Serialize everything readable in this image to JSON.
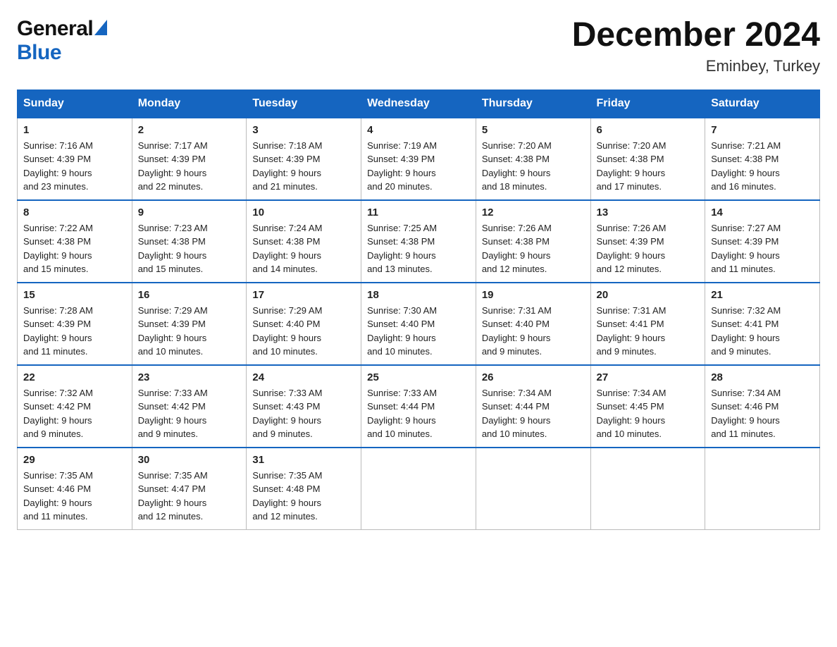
{
  "logo": {
    "general": "General",
    "blue": "Blue"
  },
  "title": "December 2024",
  "subtitle": "Eminbey, Turkey",
  "days_of_week": [
    "Sunday",
    "Monday",
    "Tuesday",
    "Wednesday",
    "Thursday",
    "Friday",
    "Saturday"
  ],
  "weeks": [
    [
      {
        "day": "1",
        "sunrise": "7:16 AM",
        "sunset": "4:39 PM",
        "daylight": "9 hours and 23 minutes."
      },
      {
        "day": "2",
        "sunrise": "7:17 AM",
        "sunset": "4:39 PM",
        "daylight": "9 hours and 22 minutes."
      },
      {
        "day": "3",
        "sunrise": "7:18 AM",
        "sunset": "4:39 PM",
        "daylight": "9 hours and 21 minutes."
      },
      {
        "day": "4",
        "sunrise": "7:19 AM",
        "sunset": "4:39 PM",
        "daylight": "9 hours and 20 minutes."
      },
      {
        "day": "5",
        "sunrise": "7:20 AM",
        "sunset": "4:38 PM",
        "daylight": "9 hours and 18 minutes."
      },
      {
        "day": "6",
        "sunrise": "7:20 AM",
        "sunset": "4:38 PM",
        "daylight": "9 hours and 17 minutes."
      },
      {
        "day": "7",
        "sunrise": "7:21 AM",
        "sunset": "4:38 PM",
        "daylight": "9 hours and 16 minutes."
      }
    ],
    [
      {
        "day": "8",
        "sunrise": "7:22 AM",
        "sunset": "4:38 PM",
        "daylight": "9 hours and 15 minutes."
      },
      {
        "day": "9",
        "sunrise": "7:23 AM",
        "sunset": "4:38 PM",
        "daylight": "9 hours and 15 minutes."
      },
      {
        "day": "10",
        "sunrise": "7:24 AM",
        "sunset": "4:38 PM",
        "daylight": "9 hours and 14 minutes."
      },
      {
        "day": "11",
        "sunrise": "7:25 AM",
        "sunset": "4:38 PM",
        "daylight": "9 hours and 13 minutes."
      },
      {
        "day": "12",
        "sunrise": "7:26 AM",
        "sunset": "4:38 PM",
        "daylight": "9 hours and 12 minutes."
      },
      {
        "day": "13",
        "sunrise": "7:26 AM",
        "sunset": "4:39 PM",
        "daylight": "9 hours and 12 minutes."
      },
      {
        "day": "14",
        "sunrise": "7:27 AM",
        "sunset": "4:39 PM",
        "daylight": "9 hours and 11 minutes."
      }
    ],
    [
      {
        "day": "15",
        "sunrise": "7:28 AM",
        "sunset": "4:39 PM",
        "daylight": "9 hours and 11 minutes."
      },
      {
        "day": "16",
        "sunrise": "7:29 AM",
        "sunset": "4:39 PM",
        "daylight": "9 hours and 10 minutes."
      },
      {
        "day": "17",
        "sunrise": "7:29 AM",
        "sunset": "4:40 PM",
        "daylight": "9 hours and 10 minutes."
      },
      {
        "day": "18",
        "sunrise": "7:30 AM",
        "sunset": "4:40 PM",
        "daylight": "9 hours and 10 minutes."
      },
      {
        "day": "19",
        "sunrise": "7:31 AM",
        "sunset": "4:40 PM",
        "daylight": "9 hours and 9 minutes."
      },
      {
        "day": "20",
        "sunrise": "7:31 AM",
        "sunset": "4:41 PM",
        "daylight": "9 hours and 9 minutes."
      },
      {
        "day": "21",
        "sunrise": "7:32 AM",
        "sunset": "4:41 PM",
        "daylight": "9 hours and 9 minutes."
      }
    ],
    [
      {
        "day": "22",
        "sunrise": "7:32 AM",
        "sunset": "4:42 PM",
        "daylight": "9 hours and 9 minutes."
      },
      {
        "day": "23",
        "sunrise": "7:33 AM",
        "sunset": "4:42 PM",
        "daylight": "9 hours and 9 minutes."
      },
      {
        "day": "24",
        "sunrise": "7:33 AM",
        "sunset": "4:43 PM",
        "daylight": "9 hours and 9 minutes."
      },
      {
        "day": "25",
        "sunrise": "7:33 AM",
        "sunset": "4:44 PM",
        "daylight": "9 hours and 10 minutes."
      },
      {
        "day": "26",
        "sunrise": "7:34 AM",
        "sunset": "4:44 PM",
        "daylight": "9 hours and 10 minutes."
      },
      {
        "day": "27",
        "sunrise": "7:34 AM",
        "sunset": "4:45 PM",
        "daylight": "9 hours and 10 minutes."
      },
      {
        "day": "28",
        "sunrise": "7:34 AM",
        "sunset": "4:46 PM",
        "daylight": "9 hours and 11 minutes."
      }
    ],
    [
      {
        "day": "29",
        "sunrise": "7:35 AM",
        "sunset": "4:46 PM",
        "daylight": "9 hours and 11 minutes."
      },
      {
        "day": "30",
        "sunrise": "7:35 AM",
        "sunset": "4:47 PM",
        "daylight": "9 hours and 12 minutes."
      },
      {
        "day": "31",
        "sunrise": "7:35 AM",
        "sunset": "4:48 PM",
        "daylight": "9 hours and 12 minutes."
      },
      null,
      null,
      null,
      null
    ]
  ],
  "labels": {
    "sunrise": "Sunrise:",
    "sunset": "Sunset:",
    "daylight": "Daylight:"
  }
}
